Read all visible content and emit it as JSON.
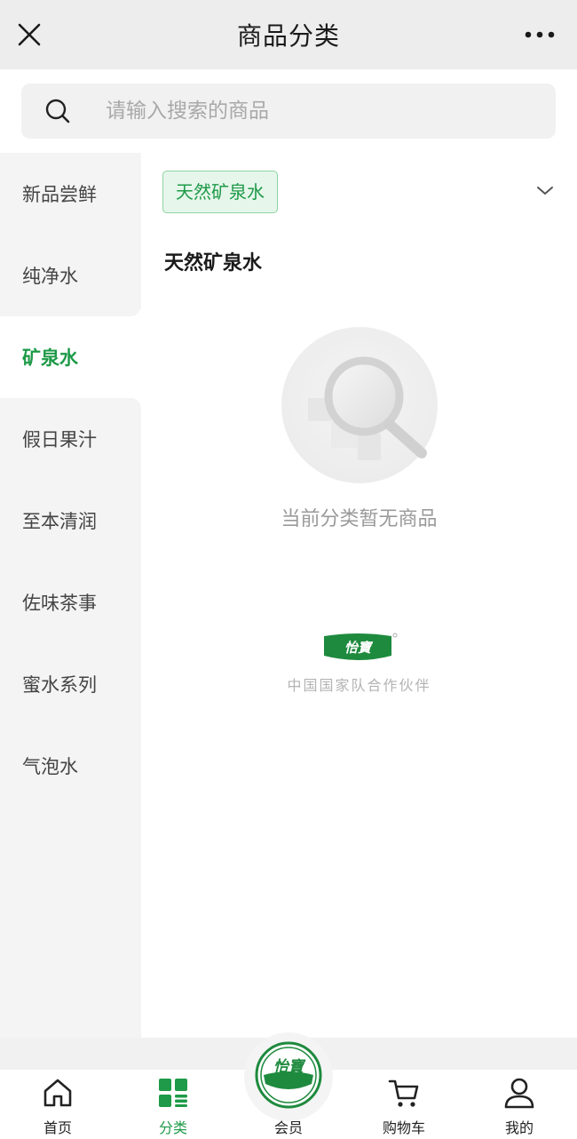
{
  "header": {
    "title": "商品分类",
    "close_icon": "close-icon",
    "more_icon": "more-dots-icon"
  },
  "search": {
    "placeholder": "请输入搜索的商品",
    "icon": "search-icon"
  },
  "sidebar": {
    "items": [
      {
        "label": "新品尝鲜"
      },
      {
        "label": "纯净水"
      },
      {
        "label": "矿泉水"
      },
      {
        "label": "假日果汁"
      },
      {
        "label": "至本清润"
      },
      {
        "label": "佐味茶事"
      },
      {
        "label": "蜜水系列"
      },
      {
        "label": "气泡水"
      }
    ],
    "active_label": "矿泉水"
  },
  "content": {
    "chip_label": "天然矿泉水",
    "section_title": "天然矿泉水",
    "empty_text": "当前分类暂无商品",
    "brand_logo_text": "怡寶",
    "brand_caption": "中国国家队合作伙伴"
  },
  "tabbar": {
    "items": [
      {
        "label": "首页",
        "icon": "home-icon"
      },
      {
        "label": "分类",
        "icon": "category-grid-icon"
      },
      {
        "label": "会员",
        "icon": "brand-logo-icon"
      },
      {
        "label": "购物车",
        "icon": "cart-icon"
      },
      {
        "label": "我的",
        "icon": "user-icon"
      }
    ],
    "active": "分类"
  },
  "colors": {
    "accent": "#1e9a48",
    "chip_bg": "#e6f6eb",
    "header_bg": "#ededed",
    "sidebar_bg": "#f4f4f4"
  }
}
